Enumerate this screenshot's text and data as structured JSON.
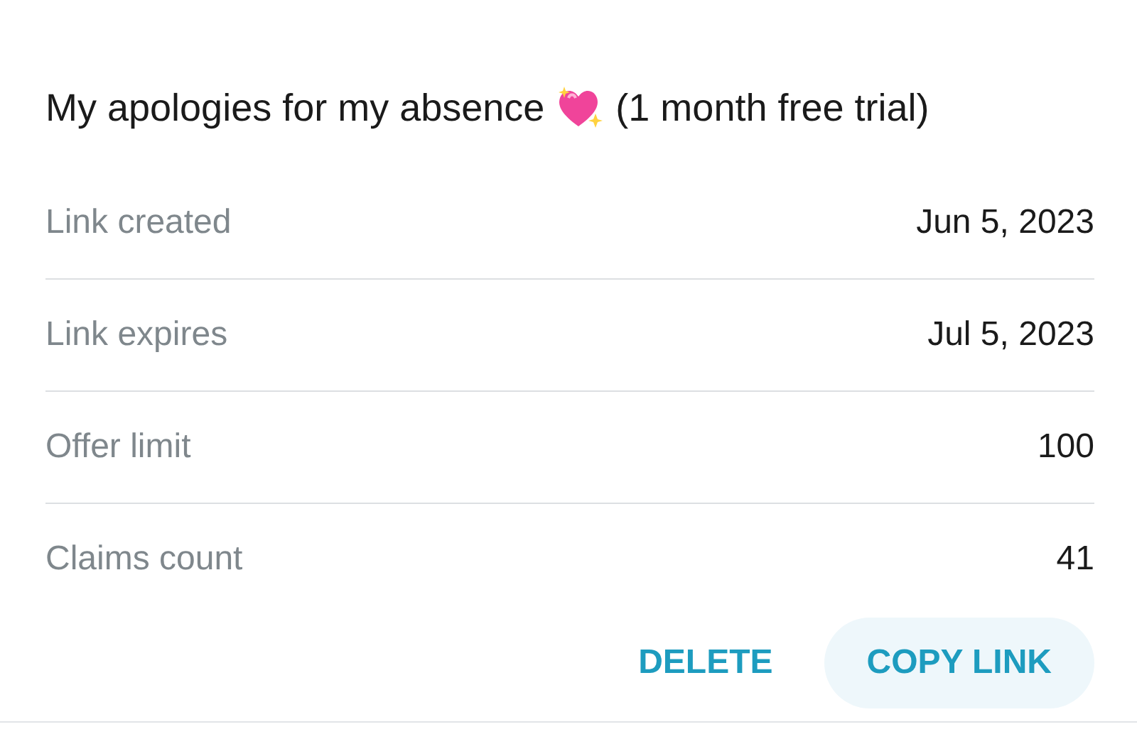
{
  "title": {
    "before": "My apologies for my absence",
    "after": "(1 month free trial)"
  },
  "rows": [
    {
      "label": "Link created",
      "value": "Jun 5, 2023"
    },
    {
      "label": "Link expires",
      "value": "Jul 5, 2023"
    },
    {
      "label": "Offer limit",
      "value": "100"
    },
    {
      "label": "Claims count",
      "value": "41"
    }
  ],
  "buttons": [
    {
      "label": "DELETE",
      "kind": "text"
    },
    {
      "label": "COPY LINK",
      "kind": "filled"
    }
  ]
}
